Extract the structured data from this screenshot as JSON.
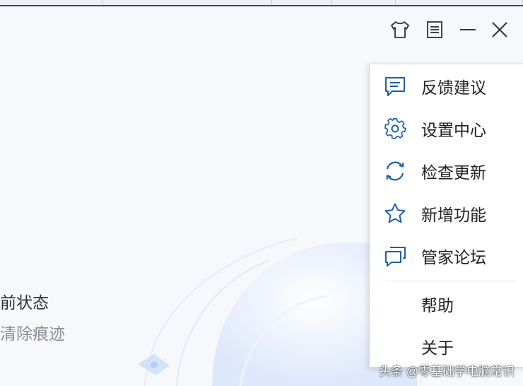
{
  "window": {
    "status_text": "前状态",
    "clear_traces_text": "清除痕迹"
  },
  "titlebar": {
    "icons": [
      "shirt-icon",
      "menu-icon",
      "minimize-icon",
      "close-icon"
    ]
  },
  "menu": {
    "items": [
      {
        "label": "反馈建议",
        "icon": "feedback-icon"
      },
      {
        "label": "设置中心",
        "icon": "gear-icon"
      },
      {
        "label": "检查更新",
        "icon": "refresh-icon"
      },
      {
        "label": "新增功能",
        "icon": "star-icon"
      },
      {
        "label": "管家论坛",
        "icon": "chat-icon"
      },
      {
        "label": "帮助"
      },
      {
        "label": "关于"
      }
    ]
  },
  "watermark": "头条 @零基础学电脑常识",
  "colors": {
    "accent": "#1d5fa8",
    "window_bg": "#f6f8fc",
    "menu_bg": "#ffffff"
  }
}
